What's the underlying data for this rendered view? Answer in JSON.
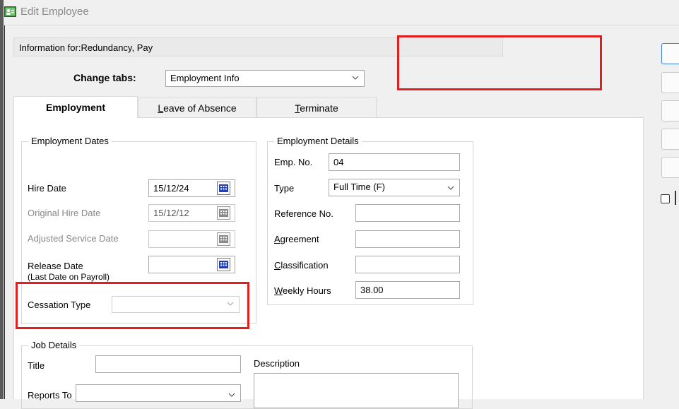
{
  "window": {
    "title": "Edit Employee",
    "icon": "employee-card-icon"
  },
  "info": {
    "label": "Information for:",
    "name": "Redundancy, Pay"
  },
  "change_tabs": {
    "label": "Change tabs:",
    "value": "Employment Info"
  },
  "tabs": [
    {
      "label": "Employment",
      "active": true
    },
    {
      "label_prefix": "",
      "label_hotkey": "L",
      "label_rest": "eave of Absence"
    },
    {
      "label_prefix": "",
      "label_hotkey": "T",
      "label_rest": "erminate"
    }
  ],
  "employment_dates": {
    "legend": "Employment Dates",
    "hire_date": {
      "label": "Hire Date",
      "value": "15/12/24"
    },
    "original_hire_date": {
      "label": "Original Hire Date",
      "value": "15/12/12"
    },
    "adjusted_service_date": {
      "label": "Adjusted Service Date",
      "value": ""
    },
    "release_date": {
      "label": "Release Date",
      "label2": "(Last Date on Payroll)",
      "value": ""
    },
    "cessation_type": {
      "label": "Cessation Type",
      "value": ""
    }
  },
  "employment_details": {
    "legend": "Employment Details",
    "emp_no": {
      "label": "Emp. No.",
      "value": "04"
    },
    "type": {
      "label": "Type",
      "value": "Full Time (F)"
    },
    "reference_no": {
      "label": "Reference No.",
      "value": ""
    },
    "agreement": {
      "hotkey": "A",
      "rest": "greement",
      "value": ""
    },
    "classification": {
      "hotkey": "C",
      "rest": "lassification",
      "value": ""
    },
    "weekly_hours": {
      "hotkey": "W",
      "rest": "eekly Hours",
      "value": "38.00"
    }
  },
  "job_details": {
    "legend": "Job Details",
    "title": {
      "label": "Title",
      "value": ""
    },
    "description": {
      "label": "Description",
      "value": ""
    },
    "reports_to": {
      "label": "Reports To",
      "value": ""
    }
  },
  "colors": {
    "highlight_box": "#e02020",
    "calendar_active": "#1f3fbf",
    "calendar_disabled": "#8a8a8a"
  }
}
